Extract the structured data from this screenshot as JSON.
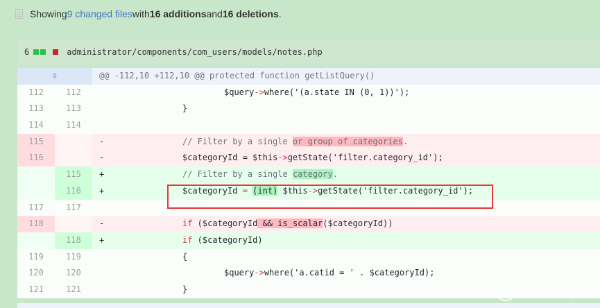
{
  "summary": {
    "prefix": "Showing ",
    "changed_files": "9 changed files",
    "mid": " with ",
    "additions": "16 additions",
    "and": " and ",
    "deletions": "16 deletions",
    "suffix": "."
  },
  "file": {
    "count": "6",
    "path": "administrator/components/com_users/models/notes.php"
  },
  "hunk_header": "@@ -112,10 +112,10 @@ protected function getListQuery()",
  "lines": [
    {
      "old": "112",
      "new": "112"
    },
    {
      "old": "113",
      "new": "113"
    },
    {
      "old": "114",
      "new": "114"
    },
    {
      "old": "115",
      "new": ""
    },
    {
      "old": "116",
      "new": ""
    },
    {
      "old": "",
      "new": "115"
    },
    {
      "old": "",
      "new": "116"
    },
    {
      "old": "117",
      "new": "117"
    },
    {
      "old": "118",
      "new": ""
    },
    {
      "old": "",
      "new": "118"
    },
    {
      "old": "119",
      "new": "119"
    },
    {
      "old": "120",
      "new": "120"
    },
    {
      "old": "121",
      "new": "121"
    }
  ],
  "code": {
    "l112_a": "$query",
    "l112_b": "->",
    "l112_c": "where('(a.state IN (0, 1))');",
    "l113": "}",
    "l115_a": "// Filter by a single ",
    "l115_b": "or group of categories",
    "l115_c": ".",
    "l116_a": "$categoryId = $this",
    "l116_b": "->",
    "l116_c": "getState('filter.category_id');",
    "n115_a": "// Filter by a single ",
    "n115_b": "category",
    "n115_c": ".",
    "n116_a": "$categoryId ",
    "n116_b": "=",
    "n116_c": " ",
    "n116_d": "(int)",
    "n116_e": " $this",
    "n116_f": "->",
    "n116_g": "getState('filter.category_id');",
    "l118_a": "if",
    "l118_b": " ($categoryId",
    "l118_c": " && is_scalar",
    "l118_d": "($categoryId))",
    "n118_a": "if",
    "n118_b": " ($categoryId)",
    "l119": "{",
    "l120_a": "$query",
    "l120_b": "->",
    "l120_c": "where('a.catid = ' . $categoryId);",
    "l121": "}"
  },
  "markers": {
    "del": "-",
    "add": "+"
  },
  "watermark": "Seebug",
  "icons": {
    "file": "file-diff-icon",
    "expand": "expand-icon"
  }
}
